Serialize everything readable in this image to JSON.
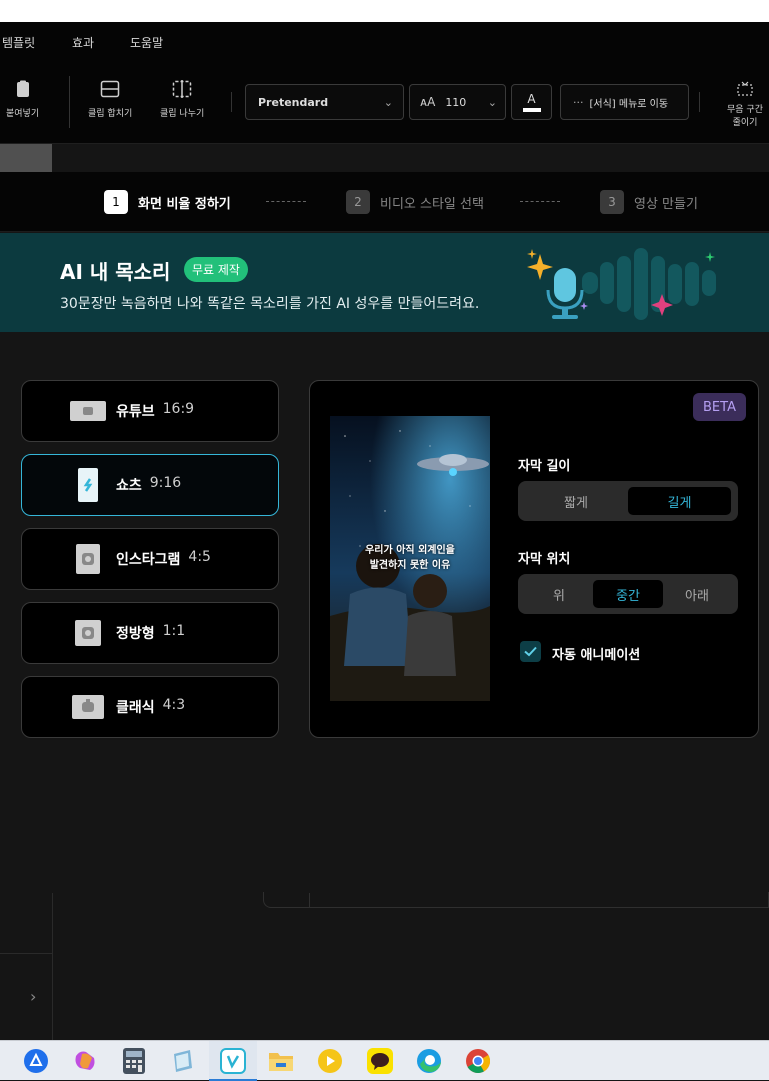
{
  "menubar": {
    "items": [
      "템플릿",
      "효과",
      "도움말"
    ]
  },
  "toolbar": {
    "paste": "붙여넣기",
    "merge": "클립 합치기",
    "split": "클립 나누기",
    "font": "Pretendard",
    "size": "110",
    "format_menu": "[서식] 메뉴로 이동",
    "silence_line1": "무음 구간",
    "silence_line2": "줄이기"
  },
  "steps": [
    {
      "num": "1",
      "label": "화면 비율 정하기"
    },
    {
      "num": "2",
      "label": "비디오 스타일 선택"
    },
    {
      "num": "3",
      "label": "영상 만들기"
    }
  ],
  "banner": {
    "title": "AI 내 목소리",
    "badge": "무료 제작",
    "subtitle": "30문장만 녹음하면 나와 똑같은 목소리를 가진 AI 성우를 만들어드려요."
  },
  "ratios": [
    {
      "name": "유튜브",
      "ratio": "16:9"
    },
    {
      "name": "쇼츠",
      "ratio": "9:16"
    },
    {
      "name": "인스타그램",
      "ratio": "4:5"
    },
    {
      "name": "정방형",
      "ratio": "1:1"
    },
    {
      "name": "클래식",
      "ratio": "4:3"
    }
  ],
  "selected_ratio": "쇼츠",
  "panel": {
    "beta": "BETA",
    "caption_line1": "우리가 아직 외계인을",
    "caption_line2": "발견하지 못한 이유",
    "length_label": "자막 길이",
    "length_options": [
      "짧게",
      "길게"
    ],
    "length_selected": "길게",
    "position_label": "자막 위치",
    "position_options": [
      "위",
      "중간",
      "아래"
    ],
    "position_selected": "중간",
    "auto_anim": "자동 애니메이션",
    "auto_anim_checked": true
  },
  "sidebar_arrow": "›",
  "colors": {
    "accent": "#35b6d8",
    "banner_bg": "#0c3a3f",
    "badge": "#22c07a",
    "beta_bg": "#3b2d5a"
  },
  "taskbar_icons": [
    "copilot-app-icon",
    "copilot-icon",
    "calculator-icon",
    "notepad-icon",
    "vrew-icon",
    "file-explorer-icon",
    "media-player-icon",
    "kakaotalk-icon",
    "edge-icon",
    "chrome-icon"
  ]
}
